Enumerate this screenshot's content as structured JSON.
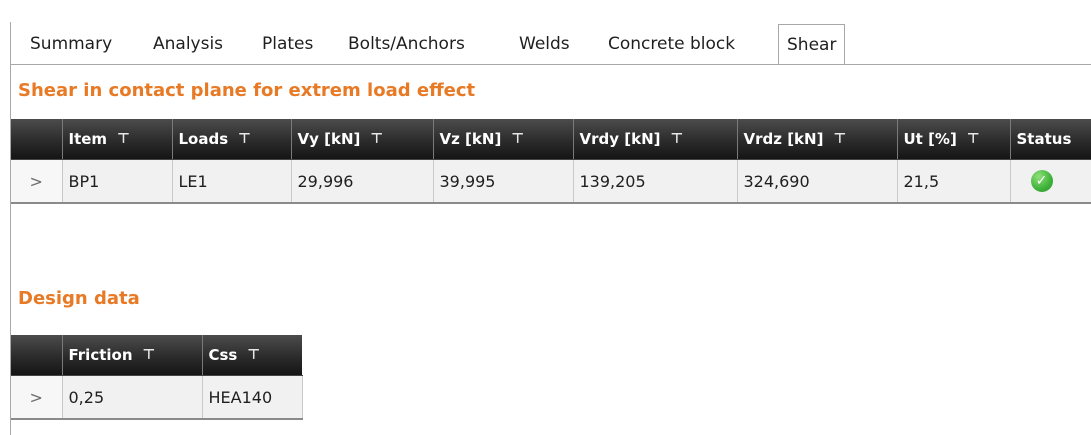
{
  "tabs": [
    {
      "label": "Summary",
      "active": false
    },
    {
      "label": "Analysis",
      "active": false
    },
    {
      "label": "Plates",
      "active": false
    },
    {
      "label": "Bolts/Anchors",
      "active": false
    },
    {
      "label": "Welds",
      "active": false
    },
    {
      "label": "Concrete block",
      "active": false
    },
    {
      "label": "Shear",
      "active": true
    }
  ],
  "shear_section": {
    "title": "Shear in contact plane for extrem load effect",
    "columns": [
      "Item",
      "Loads",
      "Vy [kN]",
      "Vz [kN]",
      "Vrdy [kN]",
      "Vrdz [kN]",
      "Ut [%]",
      "Status"
    ],
    "rows": [
      {
        "expander": ">",
        "item": "BP1",
        "loads": "LE1",
        "vy": "29,996",
        "vz": "39,995",
        "vrdy": "139,205",
        "vrdz": "324,690",
        "ut": "21,5",
        "status_icon": "check-circle-icon",
        "status_color": "#3fb23a"
      }
    ]
  },
  "design_section": {
    "title": "Design data",
    "columns": [
      "Friction",
      "Css"
    ],
    "rows": [
      {
        "expander": ">",
        "friction": "0,25",
        "css": "HEA140"
      }
    ]
  },
  "colors": {
    "section_title": "#e87a26",
    "header_bg": "#2b2b2b",
    "row_bg": "#f1f1f1"
  },
  "icons": {
    "filter": "filter-icon",
    "expander": "chevron-right-icon",
    "status_ok": "check-circle-icon"
  }
}
